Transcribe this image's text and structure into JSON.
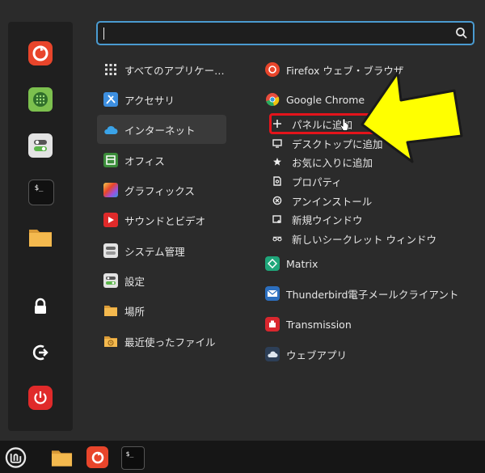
{
  "search": {
    "value": "",
    "placeholder": ""
  },
  "favorites": [
    {
      "name": "firefox",
      "icon": "firefox-icon"
    },
    {
      "name": "calculator",
      "icon": "calculator-icon"
    },
    {
      "name": "settings-toggle",
      "icon": "toggle-settings-icon"
    },
    {
      "name": "terminal",
      "icon": "terminal-icon"
    },
    {
      "name": "files",
      "icon": "folder-icon"
    },
    {
      "name": "lock-screen",
      "icon": "lock-icon"
    },
    {
      "name": "logout",
      "icon": "logout-icon"
    },
    {
      "name": "shutdown",
      "icon": "power-icon"
    }
  ],
  "categories": [
    {
      "label": "すべてのアプリケー…",
      "icon": "grid-icon"
    },
    {
      "label": "アクセサリ",
      "icon": "accessories-icon"
    },
    {
      "label": "インターネット",
      "icon": "cloud-icon",
      "selected": true
    },
    {
      "label": "オフィス",
      "icon": "office-icon"
    },
    {
      "label": "グラフィックス",
      "icon": "graphics-icon"
    },
    {
      "label": "サウンドとビデオ",
      "icon": "play-icon"
    },
    {
      "label": "システム管理",
      "icon": "system-admin-icon"
    },
    {
      "label": "設定",
      "icon": "toggle-settings-icon"
    },
    {
      "label": "場所",
      "icon": "folder-icon"
    },
    {
      "label": "最近使ったファイル",
      "icon": "recent-files-icon"
    }
  ],
  "apps": {
    "firefox": "Firefox ウェブ・ブラウザ",
    "chrome": "Google Chrome",
    "matrix": "Matrix",
    "thunderbird": "Thunderbird電子メールクライアント",
    "transmission": "Transmission",
    "webapps": "ウェブアプリ"
  },
  "context_menu": [
    {
      "label": "パネルに追加",
      "icon": "plus-icon"
    },
    {
      "label": "デスクトップに追加",
      "icon": "desktop-icon"
    },
    {
      "label": "お気に入りに追加",
      "icon": "star-icon"
    },
    {
      "label": "プロパティ",
      "icon": "properties-icon"
    },
    {
      "label": "アンインストール",
      "icon": "uninstall-icon"
    },
    {
      "label": "新規ウインドウ",
      "icon": "new-window-icon"
    },
    {
      "label": "新しいシークレット ウィンドウ",
      "icon": "incognito-icon"
    }
  ],
  "colors": {
    "accent": "#4a9bd1",
    "highlight": "#e4141b",
    "arrow": "#ffff00"
  }
}
